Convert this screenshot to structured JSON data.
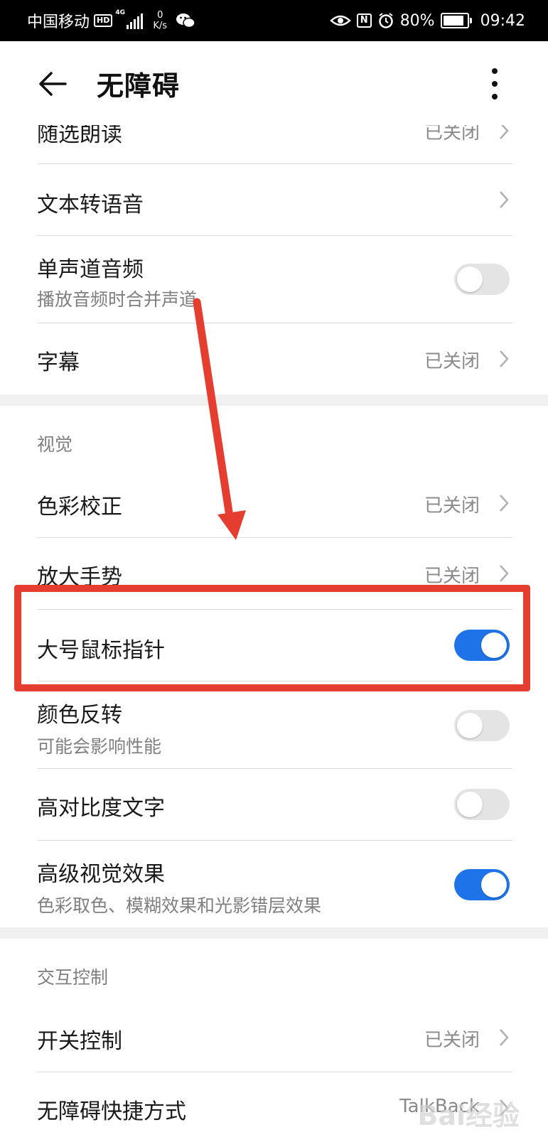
{
  "status_bar": {
    "carrier": "中国移动",
    "hd": "HD",
    "network": "4G",
    "speed_value": "0",
    "speed_unit": "K/s",
    "nfc": "N",
    "battery": "80%",
    "time": "09:42"
  },
  "header": {
    "title": "无障碍"
  },
  "rows": {
    "select_read": {
      "label": "随选朗读",
      "value": "已关闭"
    },
    "tts": {
      "label": "文本转语音"
    },
    "mono_audio": {
      "label": "单声道音频",
      "sub": "播放音频时合并声道",
      "on": false
    },
    "captions": {
      "label": "字幕",
      "value": "已关闭"
    },
    "color_correction": {
      "label": "色彩校正",
      "value": "已关闭"
    },
    "magnify": {
      "label": "放大手势",
      "value": "已关闭"
    },
    "large_pointer": {
      "label": "大号鼠标指针",
      "on": true
    },
    "color_inversion": {
      "label": "颜色反转",
      "sub": "可能会影响性能",
      "on": false
    },
    "high_contrast": {
      "label": "高对比度文字",
      "on": false
    },
    "advanced_visual": {
      "label": "高级视觉效果",
      "sub": "色彩取色、模糊效果和光影错层效果",
      "on": true
    },
    "switch_control": {
      "label": "开关控制",
      "value": "已关闭"
    },
    "shortcut": {
      "label": "无障碍快捷方式",
      "value": "TalkBack"
    }
  },
  "sections": {
    "vision": "视觉",
    "interaction": "交互控制"
  },
  "watermark": "Bai经验",
  "colors": {
    "accent": "#1e73e8",
    "annotation": "#e53e30"
  }
}
